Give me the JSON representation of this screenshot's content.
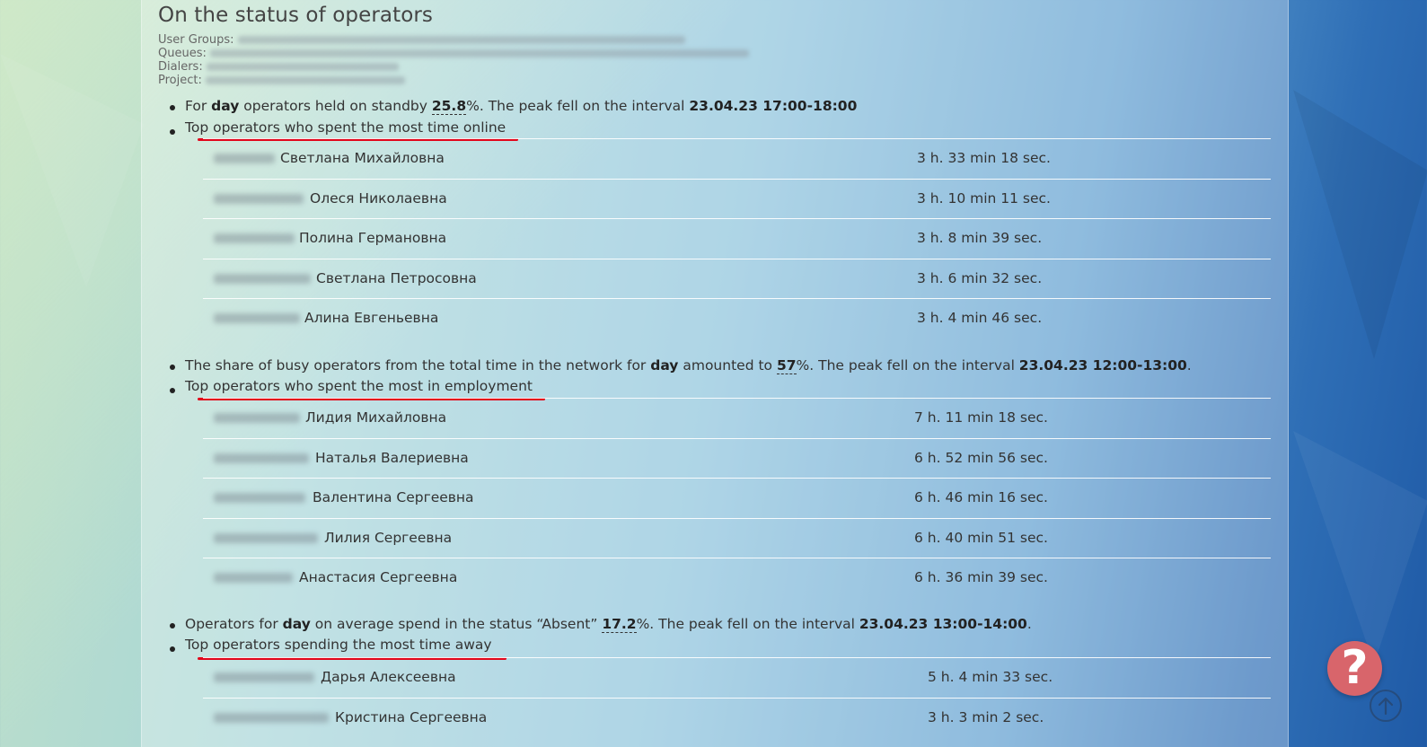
{
  "page": {
    "title": "On the status of operators"
  },
  "filters": {
    "user_groups_label": "User Groups:",
    "queues_label": "Queues:",
    "dialers_label": "Dialers:",
    "project_label": "Project:"
  },
  "sections": [
    {
      "summary": {
        "t1": "For ",
        "period": "day",
        "t2": " operators held on standby ",
        "value": "25.8",
        "t3": "%. The peak fell on the interval ",
        "interval": "23.04.23 17:00-18:00",
        "t4": ""
      },
      "top_label": "Top operators who spent the most time online",
      "rows": [
        {
          "name": "Светлана Михайловна",
          "duration": "3 h. 33 min 18 sec."
        },
        {
          "name": "Олеся Николаевна",
          "duration": "3 h. 10 min 11 sec."
        },
        {
          "name": "Полина Германовна",
          "duration": "3 h. 8 min 39 sec."
        },
        {
          "name": "Светлана Петросовна",
          "duration": "3 h. 6 min 32 sec."
        },
        {
          "name": "Алина Евгеньевна",
          "duration": "3 h. 4 min 46 sec."
        }
      ]
    },
    {
      "summary": {
        "t1": "The share of busy operators from the total time in the network for ",
        "period": "day",
        "t2": " amounted to ",
        "value": "57",
        "t3": "%. The peak fell on the interval ",
        "interval": "23.04.23 12:00-13:00",
        "t4": "."
      },
      "top_label": "Top operators who spent the most in employment",
      "rows": [
        {
          "name": "Лидия Михайловна",
          "duration": "7 h. 11 min 18 sec."
        },
        {
          "name": "Наталья Валериевна",
          "duration": "6 h. 52 min 56 sec."
        },
        {
          "name": "Валентина Сергеевна",
          "duration": "6 h. 46 min 16 sec."
        },
        {
          "name": "Лилия Сергеевна",
          "duration": "6 h. 40 min 51 sec."
        },
        {
          "name": "Анастасия Сергеевна",
          "duration": "6 h. 36 min 39 sec."
        }
      ]
    },
    {
      "summary": {
        "t1": "Operators for ",
        "period": "day",
        "t2": " on average spend in the status “Absent” ",
        "value": "17.2",
        "t3": "%. The peak fell on the interval ",
        "interval": "23.04.23 13:00-14:00",
        "t4": "."
      },
      "top_label": "Top operators spending the most time away",
      "rows": [
        {
          "name": "Дарья Алексеевна",
          "duration": "5 h. 4 min 33 sec."
        },
        {
          "name": "Кристина Сергеевна",
          "duration": "3 h. 3 min 2 sec."
        }
      ]
    }
  ],
  "help": {
    "symbol": "?"
  },
  "colors": {
    "annotation_red": "#e2061b",
    "help_button": "#d8656b"
  }
}
